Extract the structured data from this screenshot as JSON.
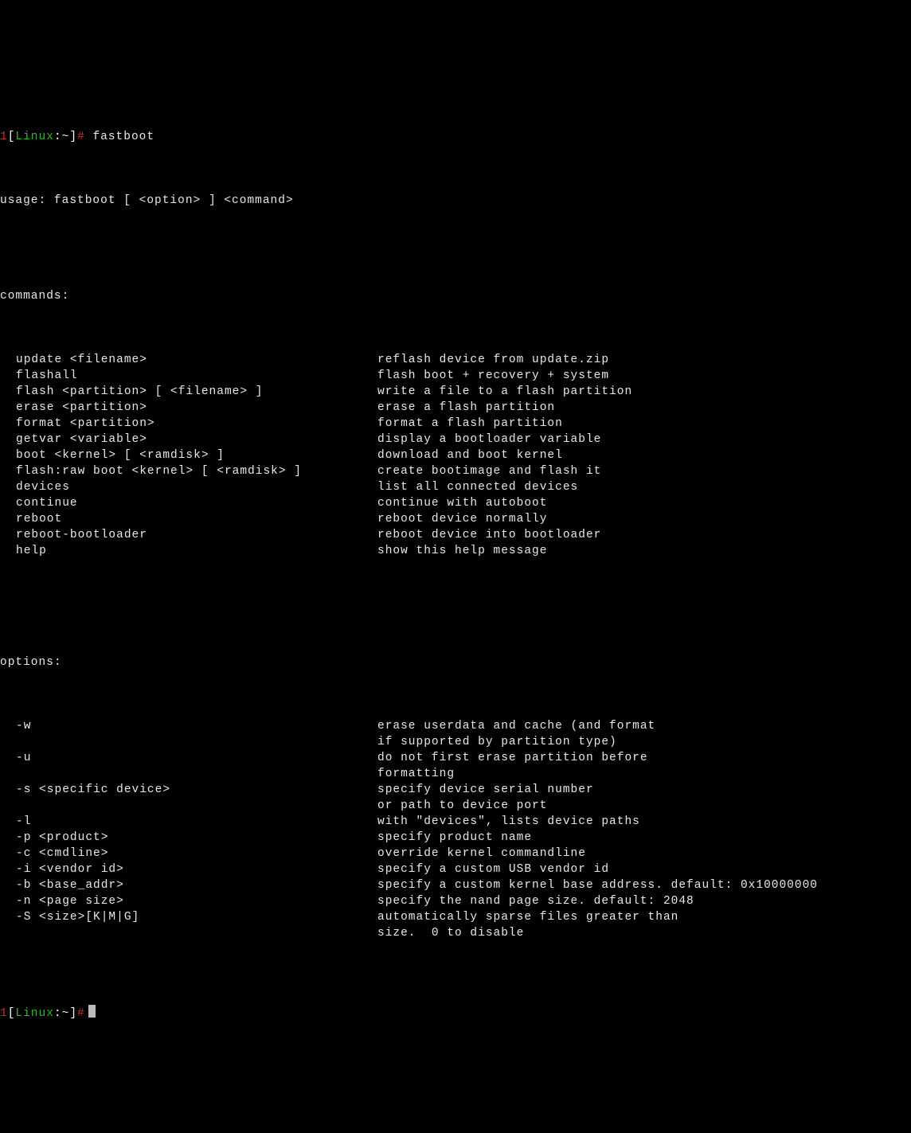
{
  "prompt": {
    "num": "1",
    "lbracket": "[",
    "host": "Linux",
    "colon": ":",
    "tilde": "~",
    "rbracket": "]",
    "hash": "#",
    "command": "fastboot"
  },
  "usage": "usage: fastboot [ <option> ] <command>",
  "commands_header": "commands:",
  "commands": [
    {
      "left": "update <filename>",
      "right": "reflash device from update.zip"
    },
    {
      "left": "flashall",
      "right": "flash boot + recovery + system"
    },
    {
      "left": "flash <partition> [ <filename> ]",
      "right": "write a file to a flash partition"
    },
    {
      "left": "erase <partition>",
      "right": "erase a flash partition"
    },
    {
      "left": "format <partition>",
      "right": "format a flash partition"
    },
    {
      "left": "getvar <variable>",
      "right": "display a bootloader variable"
    },
    {
      "left": "boot <kernel> [ <ramdisk> ]",
      "right": "download and boot kernel"
    },
    {
      "left": "flash:raw boot <kernel> [ <ramdisk> ]",
      "right": "create bootimage and flash it"
    },
    {
      "left": "devices",
      "right": "list all connected devices"
    },
    {
      "left": "continue",
      "right": "continue with autoboot"
    },
    {
      "left": "reboot",
      "right": "reboot device normally"
    },
    {
      "left": "reboot-bootloader",
      "right": "reboot device into bootloader"
    },
    {
      "left": "help",
      "right": "show this help message"
    }
  ],
  "options_header": "options:",
  "options": [
    {
      "left": "-w",
      "right": "erase userdata and cache (and format"
    },
    {
      "left": "",
      "right": "if supported by partition type)"
    },
    {
      "left": "-u",
      "right": "do not first erase partition before"
    },
    {
      "left": "",
      "right": "formatting"
    },
    {
      "left": "-s <specific device>",
      "right": "specify device serial number"
    },
    {
      "left": "",
      "right": "or path to device port"
    },
    {
      "left": "-l",
      "right": "with \"devices\", lists device paths"
    },
    {
      "left": "-p <product>",
      "right": "specify product name"
    },
    {
      "left": "-c <cmdline>",
      "right": "override kernel commandline"
    },
    {
      "left": "-i <vendor id>",
      "right": "specify a custom USB vendor id"
    },
    {
      "left": "-b <base_addr>",
      "right": "specify a custom kernel base address. default: 0x10000000"
    },
    {
      "left": "-n <page size>",
      "right": "specify the nand page size. default: 2048"
    },
    {
      "left": "-S <size>[K|M|G]",
      "right": "automatically sparse files greater than"
    },
    {
      "left": "",
      "right": "size.  0 to disable"
    }
  ]
}
